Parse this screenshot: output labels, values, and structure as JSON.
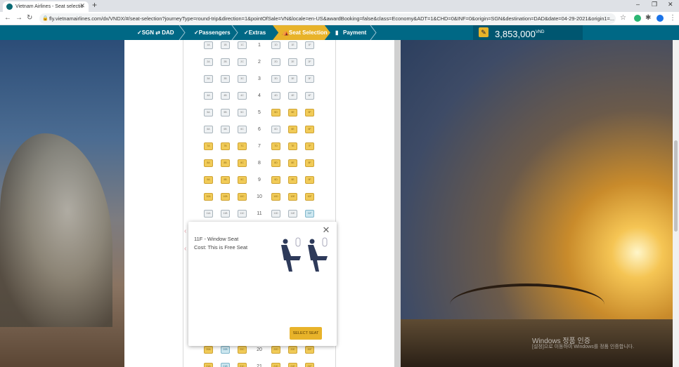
{
  "browser": {
    "tab_title": "Vietnam Airlines - Seat selectio",
    "url": "fly.vietnamairlines.com/dx/VNDX/#/seat-selection?journeyType=round-trip&direction=1&pointOfSale=VN&locale=en-US&awardBooking=false&class=Economy&ADT=1&CHD=0&INF=0&origin=SGN&destination=DAD&date=04-29-2021&origin1=..."
  },
  "steps": {
    "route": "✓SGN ⇄ DAD",
    "passengers": "✓Passengers",
    "extras": "✓Extras",
    "seat_selection": "Seat Selection",
    "payment": "Payment",
    "price": "3,853,000",
    "currency": "VND"
  },
  "seatmap": {
    "rows": [
      {
        "num": "1",
        "seats": [
          "1A",
          "1B",
          "1C",
          "1D",
          "1E",
          "1F"
        ],
        "types": [
          "n",
          "n",
          "n",
          "n",
          "n",
          "n"
        ]
      },
      {
        "num": "2",
        "seats": [
          "2A",
          "2B",
          "2C",
          "2D",
          "2E",
          "2F"
        ],
        "types": [
          "n",
          "n",
          "n",
          "n",
          "n",
          "n"
        ]
      },
      {
        "num": "3",
        "seats": [
          "3A",
          "3B",
          "3C",
          "3D",
          "3E",
          "3F"
        ],
        "types": [
          "n",
          "n",
          "n",
          "n",
          "n",
          "n"
        ]
      },
      {
        "num": "4",
        "seats": [
          "4A",
          "4B",
          "4C",
          "4D",
          "4E",
          "4F"
        ],
        "types": [
          "n",
          "n",
          "n",
          "n",
          "n",
          "n"
        ]
      },
      {
        "num": "5",
        "seats": [
          "5A",
          "5B",
          "5C",
          "5D",
          "5E",
          "5F"
        ],
        "types": [
          "n",
          "n",
          "n",
          "p",
          "p",
          "p"
        ]
      },
      {
        "num": "6",
        "seats": [
          "6A",
          "6B",
          "6C",
          "6D",
          "6E",
          "6F"
        ],
        "types": [
          "n",
          "n",
          "n",
          "n",
          "p",
          "p"
        ]
      },
      {
        "num": "7",
        "seats": [
          "7A",
          "7B",
          "7C",
          "7D",
          "7E",
          "7F"
        ],
        "types": [
          "p",
          "p",
          "p",
          "p",
          "p",
          "p"
        ]
      },
      {
        "num": "8",
        "seats": [
          "8A",
          "8B",
          "8C",
          "8D",
          "8E",
          "8F"
        ],
        "types": [
          "p",
          "p",
          "p",
          "p",
          "p",
          "p"
        ]
      },
      {
        "num": "9",
        "seats": [
          "9A",
          "9B",
          "9C",
          "9D",
          "9E",
          "9F"
        ],
        "types": [
          "p",
          "p",
          "p",
          "p",
          "p",
          "p"
        ]
      },
      {
        "num": "10",
        "seats": [
          "10A",
          "10B",
          "10C",
          "10D",
          "10E",
          "10F"
        ],
        "types": [
          "p",
          "p",
          "p",
          "p",
          "p",
          "p"
        ]
      },
      {
        "num": "11",
        "seats": [
          "11A",
          "11B",
          "11C",
          "11D",
          "11E",
          "11F"
        ],
        "types": [
          "n",
          "n",
          "n",
          "n",
          "n",
          "f"
        ]
      },
      {
        "num": "20",
        "seats": [
          "20A",
          "20B",
          "20C",
          "20D",
          "20E",
          "20F"
        ],
        "types": [
          "p",
          "f",
          "p",
          "p",
          "p",
          "p"
        ]
      },
      {
        "num": "21",
        "seats": [
          "21A",
          "21B",
          "21C",
          "21D",
          "21E",
          "21F"
        ],
        "types": [
          "p",
          "f",
          "p",
          "p",
          "p",
          "p"
        ]
      }
    ]
  },
  "popup": {
    "seat_title": "11F - Window Seat",
    "cost": "Cost: This is Free Seat",
    "button": "SELECT SEAT"
  },
  "watermark": {
    "line1": "Windows 정품 인증",
    "line2": "[설정]으로 이동하여 Windows를 정품 인증합니다."
  },
  "colors": {
    "header_bg": "#006885",
    "accent_yellow": "#e8b32a",
    "free_seat": "#cde7f0"
  }
}
